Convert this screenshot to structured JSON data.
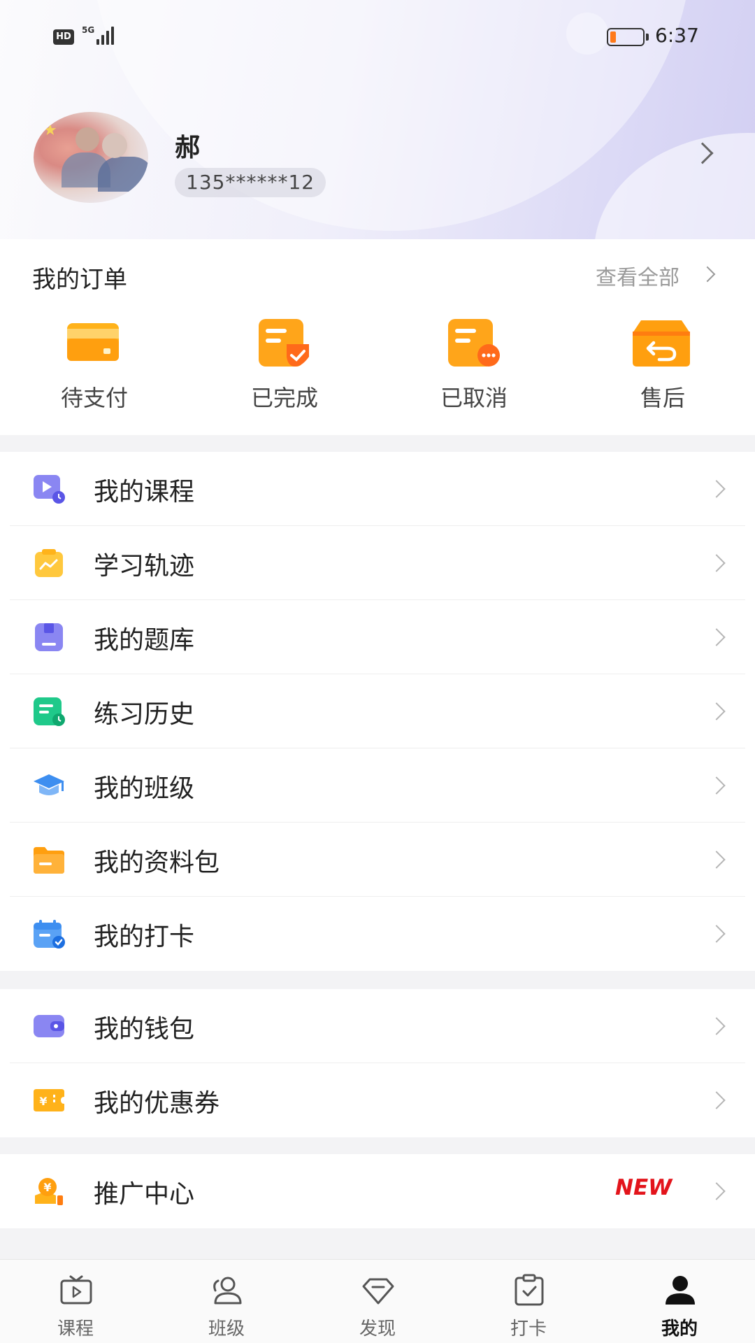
{
  "status_bar": {
    "hd": "HD",
    "network": "5G",
    "time": "6:37",
    "battery_level": 0.15
  },
  "profile": {
    "name": "郝",
    "phone": "135******12"
  },
  "orders": {
    "title": "我的订单",
    "view_all": "查看全部",
    "items": [
      {
        "label": "待支付",
        "icon": "wallet-card-icon"
      },
      {
        "label": "已完成",
        "icon": "order-done-icon"
      },
      {
        "label": "已取消",
        "icon": "order-cancelled-icon"
      },
      {
        "label": "售后",
        "icon": "after-sale-return-icon"
      }
    ]
  },
  "menu_group1": [
    {
      "label": "我的课程",
      "icon": "course-video-icon"
    },
    {
      "label": "学习轨迹",
      "icon": "learning-trend-icon"
    },
    {
      "label": "我的题库",
      "icon": "question-bank-icon"
    },
    {
      "label": "练习历史",
      "icon": "practice-history-icon"
    },
    {
      "label": "我的班级",
      "icon": "graduation-cap-icon"
    },
    {
      "label": "我的资料包",
      "icon": "folder-icon"
    },
    {
      "label": "我的打卡",
      "icon": "calendar-check-icon"
    }
  ],
  "menu_group2": [
    {
      "label": "我的钱包",
      "icon": "wallet-icon"
    },
    {
      "label": "我的优惠券",
      "icon": "coupon-icon"
    }
  ],
  "menu_group3": [
    {
      "label": "推广中心",
      "icon": "promotion-coin-icon",
      "badge": "NEW"
    }
  ],
  "tabbar": [
    {
      "label": "课程",
      "icon": "tv-play-icon",
      "active": false
    },
    {
      "label": "班级",
      "icon": "people-icon",
      "active": false
    },
    {
      "label": "发现",
      "icon": "diamond-icon",
      "active": false
    },
    {
      "label": "打卡",
      "icon": "clipboard-check-icon",
      "active": false
    },
    {
      "label": "我的",
      "icon": "person-icon",
      "active": true
    }
  ],
  "colors": {
    "accent_orange": "#ff9f0f",
    "badge_red": "#e3141b",
    "header_lavender": "#d2cff2"
  }
}
